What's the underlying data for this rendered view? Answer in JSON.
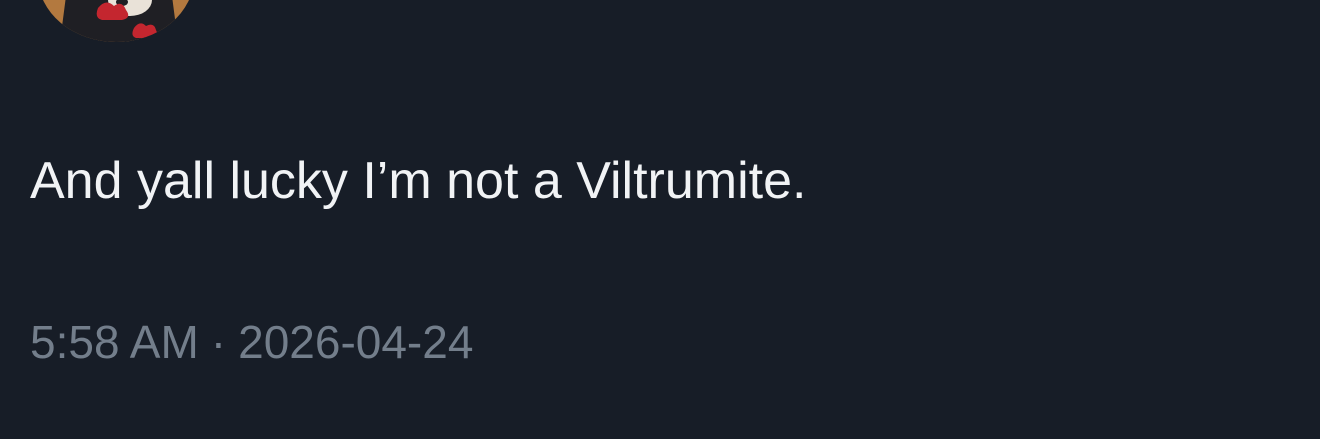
{
  "tweet": {
    "text": "And yall lucky I’m not a Viltrumite.",
    "time": "5:58 AM",
    "separator": "·",
    "date": "2026-04-24"
  },
  "avatar": {
    "icon": "profile-avatar",
    "colors": {
      "background": "#b3793f",
      "cloak": "#1f1f24",
      "cloud": "#c4262f",
      "face": "#e9e2d8"
    }
  },
  "colors": {
    "background": "#171d27",
    "text": "#f1f3f5",
    "meta": "#737e8b"
  }
}
